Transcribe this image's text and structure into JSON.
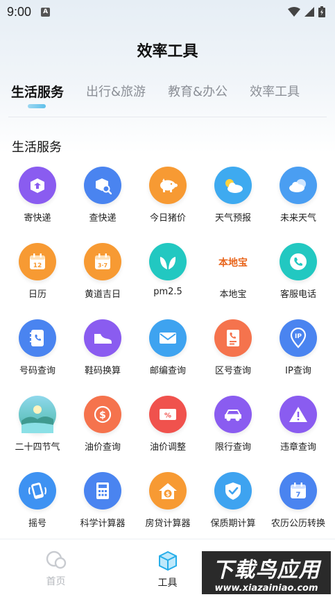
{
  "status_bar": {
    "time": "9:00",
    "notification_letter": "A"
  },
  "page": {
    "title": "效率工具"
  },
  "tabs": [
    {
      "label": "生活服务",
      "active": true
    },
    {
      "label": "出行&旅游",
      "active": false
    },
    {
      "label": "教育&办公",
      "active": false
    },
    {
      "label": "效率工具",
      "active": false
    }
  ],
  "section": {
    "title": "生活服务"
  },
  "tools": [
    {
      "label": "寄快递",
      "icon": "package-send-icon",
      "color": "#8a5cf0"
    },
    {
      "label": "查快递",
      "icon": "package-search-icon",
      "color": "#4a84f0"
    },
    {
      "label": "今日猪价",
      "icon": "pig-icon",
      "color": "#f79a33"
    },
    {
      "label": "天气预报",
      "icon": "sun-cloud-icon",
      "color": "#3eaaf0"
    },
    {
      "label": "未来天气",
      "icon": "cloud-icon",
      "color": "#4a9ef2"
    },
    {
      "label": "日历",
      "icon": "calendar-icon",
      "color": "#f79a33",
      "text": "12"
    },
    {
      "label": "黄道吉日",
      "icon": "calendar-icon",
      "color": "#f79a33",
      "text": "3·7"
    },
    {
      "label": "pm2.5",
      "icon": "leaf-icon",
      "color": "#22c8c1"
    },
    {
      "label": "本地宝",
      "icon": "bendibao-logo-icon",
      "color": "#ffffff",
      "text": "本地宝"
    },
    {
      "label": "客服电话",
      "icon": "phone-icon",
      "color": "#22c8c1"
    },
    {
      "label": "号码查询",
      "icon": "phone-book-icon",
      "color": "#4a84f0"
    },
    {
      "label": "鞋码换算",
      "icon": "shoe-icon",
      "color": "#8a5cf0"
    },
    {
      "label": "邮编查询",
      "icon": "envelope-icon",
      "color": "#3ea3f0"
    },
    {
      "label": "区号查询",
      "icon": "phone-document-icon",
      "color": "#f5734d"
    },
    {
      "label": "IP查询",
      "icon": "map-pin-icon",
      "color": "#4a84f0",
      "text": "IP"
    },
    {
      "label": "二十四节气",
      "icon": "landscape-icon",
      "color": "#58c3d8"
    },
    {
      "label": "油价查询",
      "icon": "dollar-icon",
      "color": "#f5734d",
      "text": "$"
    },
    {
      "label": "油价调整",
      "icon": "percent-tag-icon",
      "color": "#f0524d",
      "text": "%"
    },
    {
      "label": "限行查询",
      "icon": "car-icon",
      "color": "#8a5cf0"
    },
    {
      "label": "违章查询",
      "icon": "warning-icon",
      "color": "#8a5cf0"
    },
    {
      "label": "摇号",
      "icon": "phone-shake-icon",
      "color": "#3e92f2"
    },
    {
      "label": "科学计算器",
      "icon": "calculator-icon",
      "color": "#4a84f0"
    },
    {
      "label": "房贷计算器",
      "icon": "house-dollar-icon",
      "color": "#f79a33",
      "text": "$"
    },
    {
      "label": "保质期计算",
      "icon": "shield-check-icon",
      "color": "#3ea3f0"
    },
    {
      "label": "农历公历转换",
      "icon": "calendar-icon",
      "color": "#4a84f0",
      "text": "7"
    }
  ],
  "bottom_nav": [
    {
      "label": "首页",
      "icon": "home-bubble-icon",
      "active": false
    },
    {
      "label": "工具",
      "icon": "cube-icon",
      "active": true
    }
  ],
  "watermark": {
    "main": "下载鸟应用",
    "sub": "www.xiazainiao.com"
  }
}
